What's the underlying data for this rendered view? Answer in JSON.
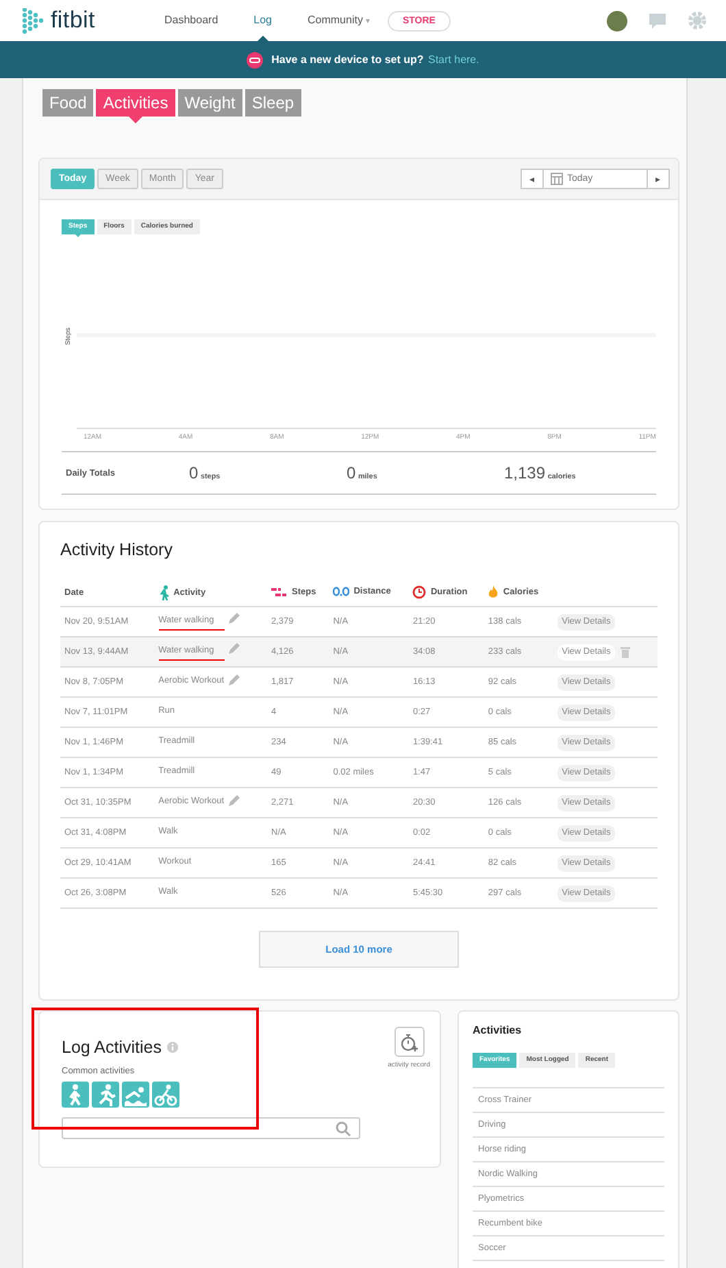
{
  "header": {
    "logo": "fitbit",
    "nav": [
      {
        "label": "Dashboard",
        "selected": false
      },
      {
        "label": "Log",
        "selected": true
      },
      {
        "label": "Community",
        "selected": false,
        "dropdown_icon": "▾"
      }
    ],
    "store": "STORE"
  },
  "banner": {
    "text": "Have a new device to set up?",
    "link": "Start here."
  },
  "tabs": [
    {
      "label": "Food",
      "selected": false
    },
    {
      "label": "Activities",
      "selected": true
    },
    {
      "label": "Weight",
      "selected": false
    },
    {
      "label": "Sleep",
      "selected": false
    }
  ],
  "period_tabs": [
    {
      "label": "Today",
      "selected": true
    },
    {
      "label": "Week",
      "selected": false
    },
    {
      "label": "Month",
      "selected": false
    },
    {
      "label": "Year",
      "selected": false
    }
  ],
  "date_picker": {
    "prev": "◂",
    "value": "Today",
    "next": "▸"
  },
  "chart": {
    "metric_tabs": [
      {
        "label": "Steps",
        "selected": true
      },
      {
        "label": "Floors",
        "selected": false
      },
      {
        "label": "Calories burned",
        "selected": false
      }
    ],
    "ylabel": "Steps",
    "x_labels": [
      "12AM",
      "4AM",
      "8AM",
      "12PM",
      "4PM",
      "8PM",
      "11PM"
    ]
  },
  "daily_totals": {
    "label": "Daily Totals",
    "items": [
      {
        "value": "0",
        "unit": "steps"
      },
      {
        "value": "0",
        "unit": "miles"
      },
      {
        "value": "1,139",
        "unit": "calories"
      }
    ]
  },
  "history": {
    "title": "Activity History",
    "columns": [
      {
        "label": "Date",
        "kind": "plain"
      },
      {
        "label": "Activity",
        "kind": "walker"
      },
      {
        "label": "Steps",
        "kind": "steps"
      },
      {
        "label": "Distance",
        "kind": "distance"
      },
      {
        "label": "Duration",
        "kind": "clock"
      },
      {
        "label": "Calories",
        "kind": "flame"
      }
    ],
    "rows": [
      {
        "date": "Nov 20, 9:51AM",
        "activity": "Water walking",
        "editable": true,
        "underlined": true,
        "hovered": false,
        "steps": "2,379",
        "distance": "N/A",
        "duration": "21:20",
        "calories": "138 cals",
        "action": "View Details"
      },
      {
        "date": "Nov 13, 9:44AM",
        "activity": "Water walking",
        "editable": true,
        "underlined": true,
        "hovered": true,
        "steps": "4,126",
        "distance": "N/A",
        "duration": "34:08",
        "calories": "233 cals",
        "action": "View Details"
      },
      {
        "date": "Nov 8, 7:05PM",
        "activity": "Aerobic Workout",
        "editable": true,
        "underlined": false,
        "hovered": false,
        "steps": "1,817",
        "distance": "N/A",
        "duration": "16:13",
        "calories": "92 cals",
        "action": "View Details"
      },
      {
        "date": "Nov 7, 11:01PM",
        "activity": "Run",
        "editable": false,
        "underlined": false,
        "hovered": false,
        "steps": "4",
        "distance": "N/A",
        "duration": "0:27",
        "calories": "0 cals",
        "action": "View Details"
      },
      {
        "date": "Nov 1, 1:46PM",
        "activity": "Treadmill",
        "editable": false,
        "underlined": false,
        "hovered": false,
        "steps": "234",
        "distance": "N/A",
        "duration": "1:39:41",
        "calories": "85 cals",
        "action": "View Details"
      },
      {
        "date": "Nov 1, 1:34PM",
        "activity": "Treadmill",
        "editable": false,
        "underlined": false,
        "hovered": false,
        "steps": "49",
        "distance": "0.02 miles",
        "duration": "1:47",
        "calories": "5 cals",
        "action": "View Details"
      },
      {
        "date": "Oct 31, 10:35PM",
        "activity": "Aerobic Workout",
        "editable": true,
        "underlined": false,
        "hovered": false,
        "steps": "2,271",
        "distance": "N/A",
        "duration": "20:30",
        "calories": "126 cals",
        "action": "View Details"
      },
      {
        "date": "Oct 31, 4:08PM",
        "activity": "Walk",
        "editable": false,
        "underlined": false,
        "hovered": false,
        "steps": "N/A",
        "distance": "N/A",
        "duration": "0:02",
        "calories": "0 cals",
        "action": "View Details"
      },
      {
        "date": "Oct 29, 10:41AM",
        "activity": "Workout",
        "editable": false,
        "underlined": false,
        "hovered": false,
        "steps": "165",
        "distance": "N/A",
        "duration": "24:41",
        "calories": "82 cals",
        "action": "View Details"
      },
      {
        "date": "Oct 26, 3:08PM",
        "activity": "Walk",
        "editable": false,
        "underlined": false,
        "hovered": false,
        "steps": "526",
        "distance": "N/A",
        "duration": "5:45:30",
        "calories": "297 cals",
        "action": "View Details"
      }
    ],
    "load_more": "Load 10 more"
  },
  "log_activities": {
    "title": "Log Activities",
    "outlined": true,
    "record_label": "activity record",
    "common_label": "Common activities",
    "common": [
      {
        "kind": "walk"
      },
      {
        "kind": "run"
      },
      {
        "kind": "swim"
      },
      {
        "kind": "bike"
      }
    ]
  },
  "activities_panel": {
    "title": "Activities",
    "tabs": [
      {
        "label": "Favorites",
        "selected": true
      },
      {
        "label": "Most Logged",
        "selected": false
      },
      {
        "label": "Recent",
        "selected": false
      }
    ],
    "items": [
      "Cross Trainer",
      "Driving",
      "Horse riding",
      "Nordic Walking",
      "Plyometrics",
      "Recumbent bike",
      "Soccer"
    ]
  }
}
